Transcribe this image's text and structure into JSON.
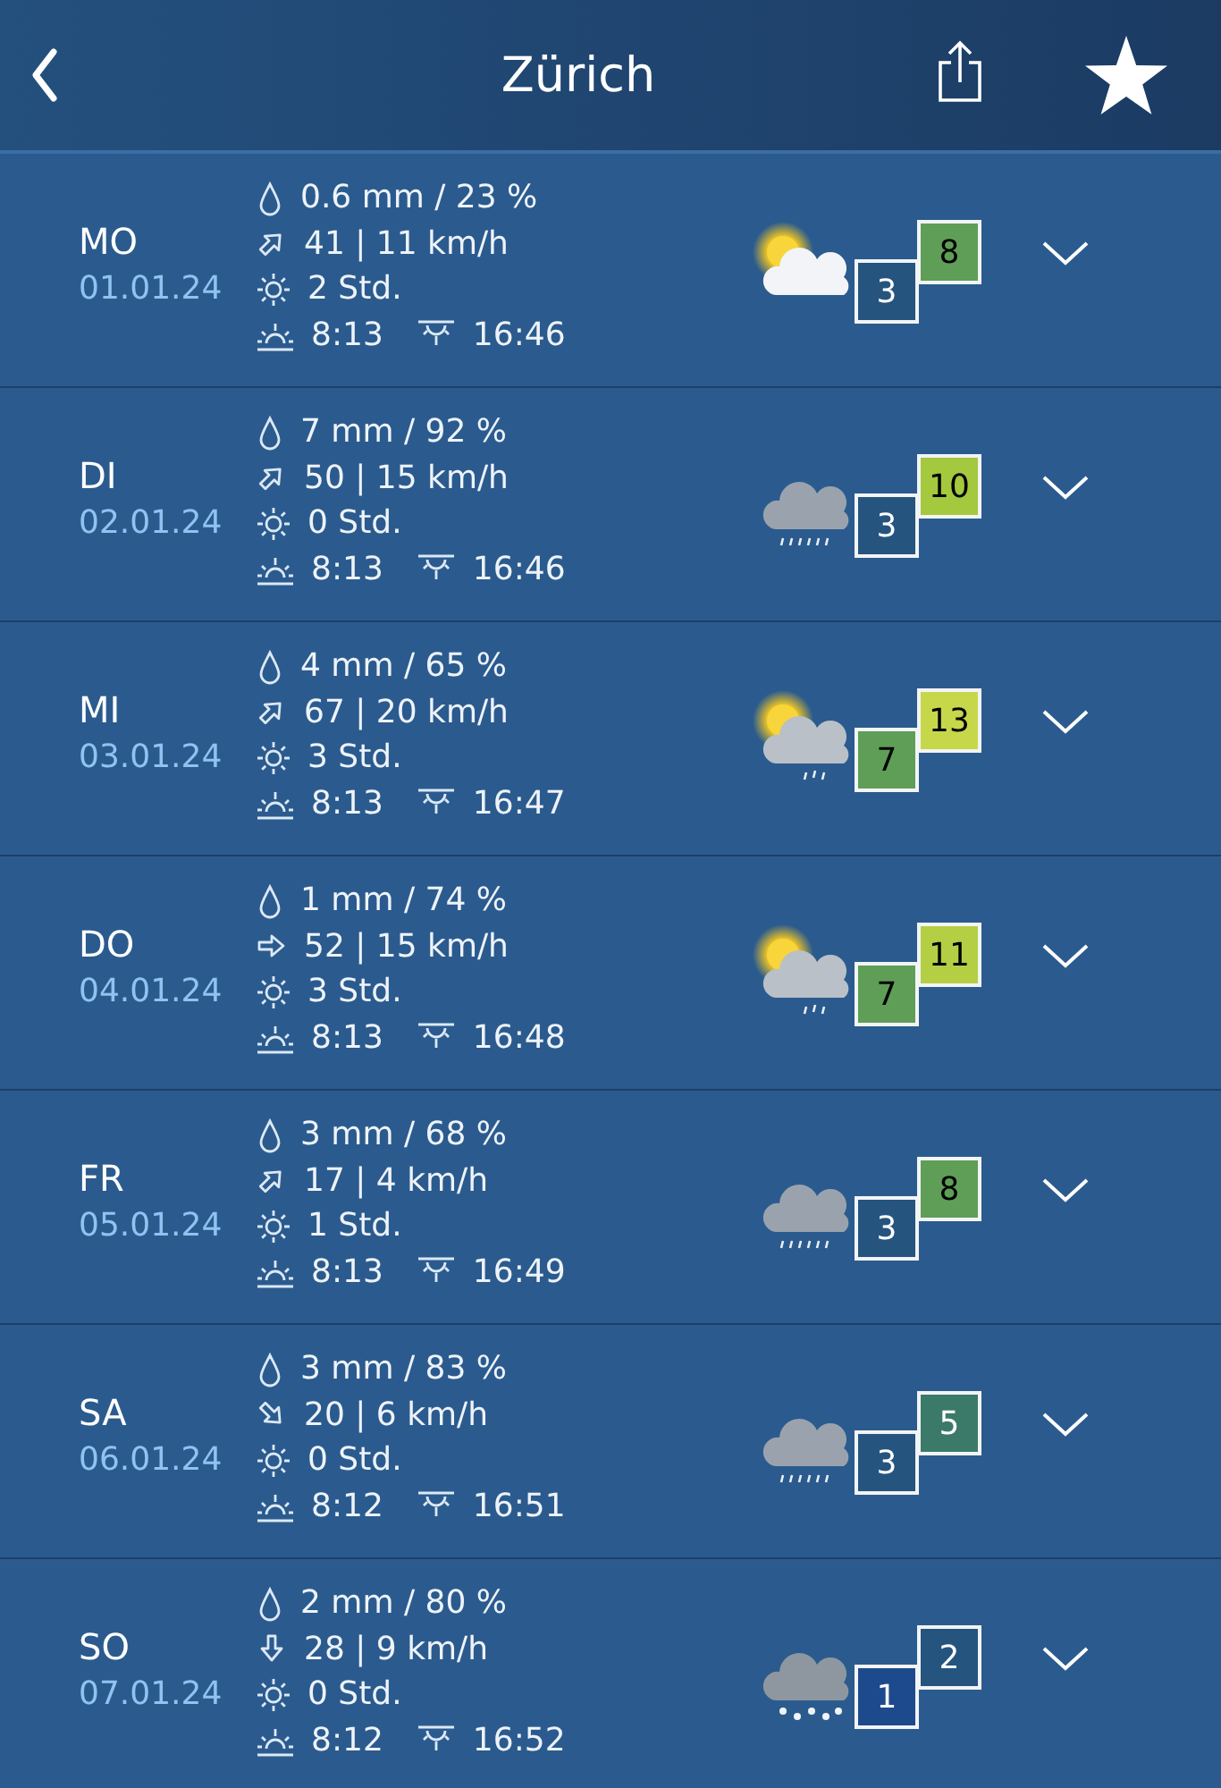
{
  "header": {
    "title": "Zürich"
  },
  "days": [
    {
      "day": "MO",
      "date": "01.01.24",
      "precip": "0.6 mm / 23 %",
      "wind": {
        "kind": "northeast",
        "value": "41 | 11 km/h"
      },
      "sunshine": "2 Std.",
      "sunrise": "8:13",
      "sunset": "16:46",
      "weather": {
        "kind": "partlycloudy"
      },
      "min": {
        "value": "3",
        "color": "#25547f"
      },
      "max": {
        "value": "8",
        "color": "#5f9e57"
      }
    },
    {
      "day": "DI",
      "date": "02.01.24",
      "precip": "7 mm / 92 %",
      "wind": {
        "kind": "northeast",
        "value": "50 | 15 km/h"
      },
      "sunshine": "0 Std.",
      "sunrise": "8:13",
      "sunset": "16:46",
      "weather": {
        "kind": "rain"
      },
      "min": {
        "value": "3",
        "color": "#25547f"
      },
      "max": {
        "value": "10",
        "color": "#a4c83e"
      }
    },
    {
      "day": "MI",
      "date": "03.01.24",
      "precip": "4 mm / 65 %",
      "wind": {
        "kind": "northeast",
        "value": "67 | 20 km/h"
      },
      "sunshine": "3 Std.",
      "sunrise": "8:13",
      "sunset": "16:47",
      "weather": {
        "kind": "showers"
      },
      "min": {
        "value": "7",
        "color": "#5f9e57"
      },
      "max": {
        "value": "13",
        "color": "#c6d84a"
      }
    },
    {
      "day": "DO",
      "date": "04.01.24",
      "precip": "1 mm / 74 %",
      "wind": {
        "kind": "east",
        "value": "52 | 15 km/h"
      },
      "sunshine": "3 Std.",
      "sunrise": "8:13",
      "sunset": "16:48",
      "weather": {
        "kind": "showers"
      },
      "min": {
        "value": "7",
        "color": "#5f9e57"
      },
      "max": {
        "value": "11",
        "color": "#b4cf44"
      }
    },
    {
      "day": "FR",
      "date": "05.01.24",
      "precip": "3 mm / 68 %",
      "wind": {
        "kind": "northeast",
        "value": "17 | 4 km/h"
      },
      "sunshine": "1 Std.",
      "sunrise": "8:13",
      "sunset": "16:49",
      "weather": {
        "kind": "rain"
      },
      "min": {
        "value": "3",
        "color": "#25547f"
      },
      "max": {
        "value": "8",
        "color": "#5f9e57"
      }
    },
    {
      "day": "SA",
      "date": "06.01.24",
      "precip": "3 mm / 83 %",
      "wind": {
        "kind": "southeast",
        "value": "20 | 6 km/h"
      },
      "sunshine": "0 Std.",
      "sunrise": "8:12",
      "sunset": "16:51",
      "weather": {
        "kind": "rain"
      },
      "min": {
        "value": "3",
        "color": "#25547f"
      },
      "max": {
        "value": "5",
        "color": "#3b7a68"
      }
    },
    {
      "day": "SO",
      "date": "07.01.24",
      "precip": "2 mm / 80 %",
      "wind": {
        "kind": "south",
        "value": "28 | 9 km/h"
      },
      "sunshine": "0 Std.",
      "sunrise": "8:12",
      "sunset": "16:52",
      "weather": {
        "kind": "snow"
      },
      "min": {
        "value": "1",
        "color": "#1d4a8c"
      },
      "max": {
        "value": "2",
        "color": "#25547f"
      }
    }
  ]
}
